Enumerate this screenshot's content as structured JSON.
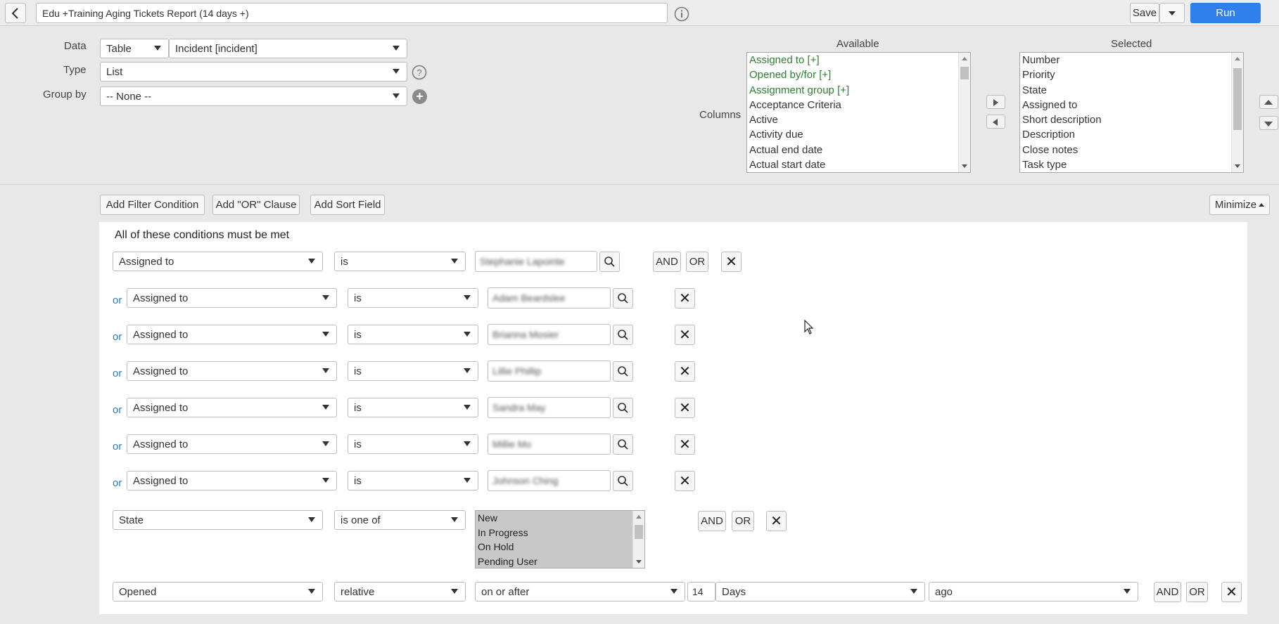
{
  "header": {
    "report_title": "Edu +Training Aging Tickets Report (14 days +)",
    "save_label": "Save",
    "run_label": "Run",
    "run_color": "#2f80ed"
  },
  "form": {
    "data_label": "Data",
    "data_source": "Table",
    "data_table": "Incident [incident]",
    "type_label": "Type",
    "type_value": "List",
    "groupby_label": "Group by",
    "groupby_value": "-- None --",
    "columns_label": "Columns",
    "available_label": "Available",
    "selected_label": "Selected",
    "available": [
      "Assigned to [+]",
      "Opened by/for [+]",
      "Assignment group [+]",
      "Acceptance Criteria",
      "Active",
      "Activity due",
      "Actual end date",
      "Actual start date"
    ],
    "selected": [
      "Number",
      "Priority",
      "State",
      "Assigned to",
      "Short description",
      "Description",
      "Close notes",
      "Task type"
    ]
  },
  "filter": {
    "add_condition": "Add Filter Condition",
    "add_or": "Add \"OR\" Clause",
    "add_sort": "Add Sort Field",
    "minimize": "Minimize",
    "heading": "All of these conditions must be met",
    "and_label": "AND",
    "or_label": "OR",
    "or_prefix": "or",
    "rows": [
      {
        "field": "Assigned to",
        "op": "is",
        "value": "Stephanie Lapointe"
      },
      {
        "field": "Assigned to",
        "op": "is",
        "value": "Adam Beardslee"
      },
      {
        "field": "Assigned to",
        "op": "is",
        "value": "Brianna Mosier"
      },
      {
        "field": "Assigned to",
        "op": "is",
        "value": "Lillie Phillip"
      },
      {
        "field": "Assigned to",
        "op": "is",
        "value": "Sandra May"
      },
      {
        "field": "Assigned to",
        "op": "is",
        "value": "Millie Mo"
      },
      {
        "field": "Assigned to",
        "op": "is",
        "value": "Johnson Ching"
      }
    ],
    "state": {
      "field": "State",
      "op": "is one of",
      "options": [
        "New",
        "In Progress",
        "On Hold",
        "Pending User"
      ]
    },
    "opened": {
      "field": "Opened",
      "op": "relative",
      "direction": "on or after",
      "amount": "14",
      "unit": "Days",
      "tense": "ago"
    }
  }
}
